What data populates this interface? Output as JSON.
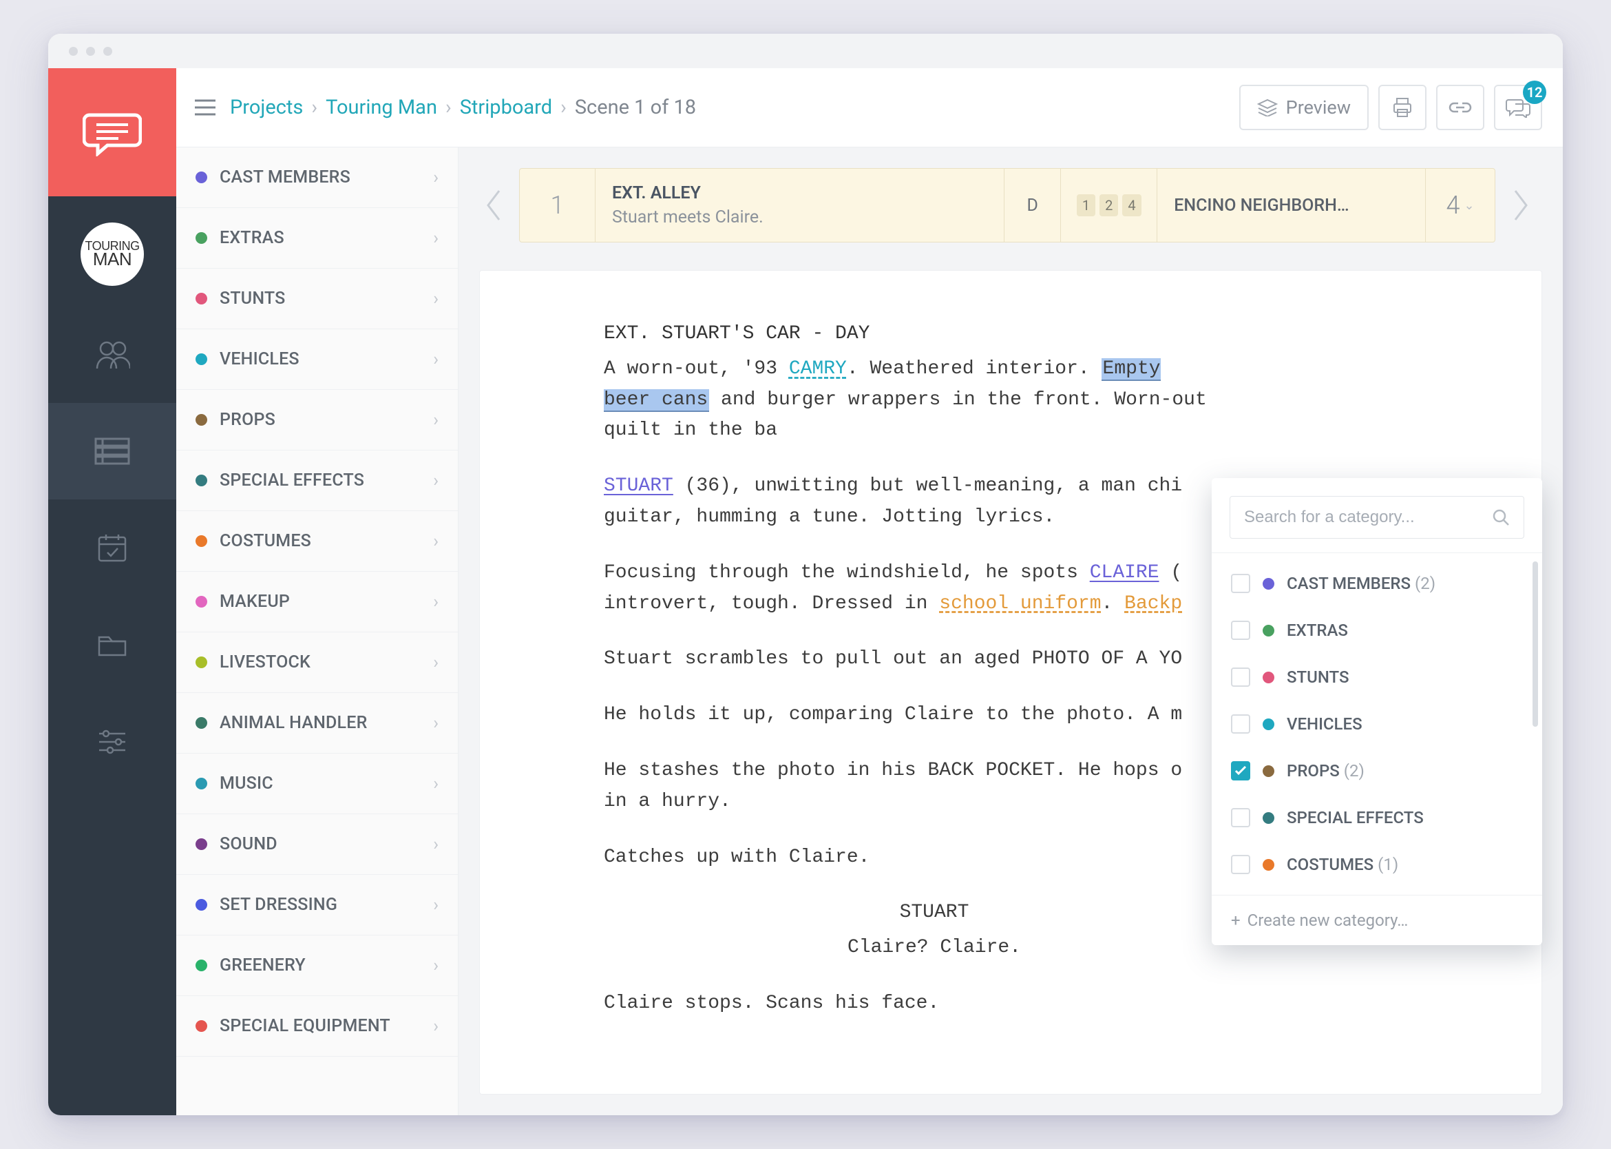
{
  "header": {
    "breadcrumbs": [
      "Projects",
      "Touring Man",
      "Stripboard"
    ],
    "current": "Scene 1 of 18",
    "preview_label": "Preview",
    "comments_badge": 12
  },
  "project_logo": {
    "line1": "TOURING",
    "line2": "MAN"
  },
  "categories": [
    {
      "label": "CAST MEMBERS",
      "color": "#6a62d8"
    },
    {
      "label": "EXTRAS",
      "color": "#49a160"
    },
    {
      "label": "STUNTS",
      "color": "#e1577c"
    },
    {
      "label": "VEHICLES",
      "color": "#1fa8c0"
    },
    {
      "label": "PROPS",
      "color": "#8a6a3f"
    },
    {
      "label": "SPECIAL EFFECTS",
      "color": "#347c80"
    },
    {
      "label": "COSTUMES",
      "color": "#e9792a"
    },
    {
      "label": "MAKEUP",
      "color": "#e266bf"
    },
    {
      "label": "LIVESTOCK",
      "color": "#a8be29"
    },
    {
      "label": "ANIMAL HANDLER",
      "color": "#3a7a68"
    },
    {
      "label": "MUSIC",
      "color": "#2a9ab2"
    },
    {
      "label": "SOUND",
      "color": "#7a3e8c"
    },
    {
      "label": "SET DRESSING",
      "color": "#4b5be0"
    },
    {
      "label": "GREENERY",
      "color": "#29b26a"
    },
    {
      "label": "SPECIAL EQUIPMENT",
      "color": "#e5554f"
    }
  ],
  "strip": {
    "number": "1",
    "scene_title": "EXT. ALLEY",
    "scene_sub": "Stuart meets Claire.",
    "tod": "D",
    "tags": [
      "1",
      "2",
      "4"
    ],
    "location": "ENCINO NEIGHBORH…",
    "pages": "4"
  },
  "script": {
    "slugline": "EXT. STUART'S CAR - DAY",
    "camry": "CAMRY",
    "empty_beer": "Empty beer cans",
    "stuart": "STUART",
    "claire": "CLAIRE",
    "school_uniform": "school uniform",
    "backp": "Backp",
    "p1a": "A worn-out, '93 ",
    "p1b": ". Weathered interior. ",
    "p1c": " and burger wrappers in the front. Worn-out quilt in the ba",
    "p2a": " (36), unwitting but well-meaning, a man chi",
    "p2b": "guitar, humming a tune. Jotting lyrics.",
    "p3a": "Focusing through the windshield, he spots ",
    "p3b": " (",
    "p3c": "introvert, tough. Dressed in ",
    "p3d": ". ",
    "p4": "Stuart scrambles to pull out an aged PHOTO OF A YO",
    "p5": "He holds it up, comparing Claire to the photo. A m",
    "p6": "He stashes the photo in his BACK POCKET. He hops o",
    "p6b": "in a hurry.",
    "p7": "Catches up with Claire.",
    "char1": "STUART",
    "dlg1": "Claire? Claire.",
    "p8": "Claire stops. Scans his face."
  },
  "popover": {
    "placeholder": "Search for a category...",
    "items": [
      {
        "label": "CAST MEMBERS",
        "count": 2,
        "color": "#6a62d8",
        "checked": false
      },
      {
        "label": "EXTRAS",
        "count": null,
        "color": "#49a160",
        "checked": false
      },
      {
        "label": "STUNTS",
        "count": null,
        "color": "#e1577c",
        "checked": false
      },
      {
        "label": "VEHICLES",
        "count": null,
        "color": "#1fa8c0",
        "checked": false
      },
      {
        "label": "PROPS",
        "count": 2,
        "color": "#8a6a3f",
        "checked": true
      },
      {
        "label": "SPECIAL EFFECTS",
        "count": null,
        "color": "#347c80",
        "checked": false
      },
      {
        "label": "COSTUMES",
        "count": 1,
        "color": "#e9792a",
        "checked": false
      }
    ],
    "create_label": "Create new category…"
  }
}
